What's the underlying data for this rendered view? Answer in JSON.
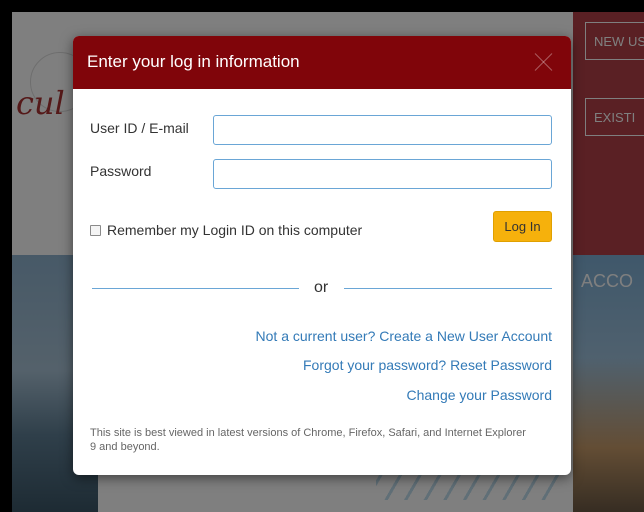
{
  "background": {
    "logo_text": "cul",
    "right_buttons": [
      "NEW US",
      "EXISTI"
    ],
    "banner_text": "ACCO"
  },
  "modal": {
    "title": "Enter your log in information",
    "close_icon": "close-icon",
    "user_label": "User ID / E-mail",
    "user_value": "",
    "password_label": "Password",
    "password_value": "",
    "remember_label": "Remember my Login ID on this computer",
    "remember_checked": false,
    "login_button": "Log In",
    "or_text": "or",
    "links": {
      "create": "Not a current user? Create a New User Account",
      "reset": "Forgot your password? Reset Password",
      "change": "Change your Password"
    },
    "footnote": "This site is best viewed in latest versions of Chrome, Firefox, Safari, and Internet Explorer 9 and beyond."
  },
  "colors": {
    "header": "#80050a",
    "login_button": "#f6b10c",
    "link": "#337ab7",
    "input_border": "#6aa6d6"
  }
}
